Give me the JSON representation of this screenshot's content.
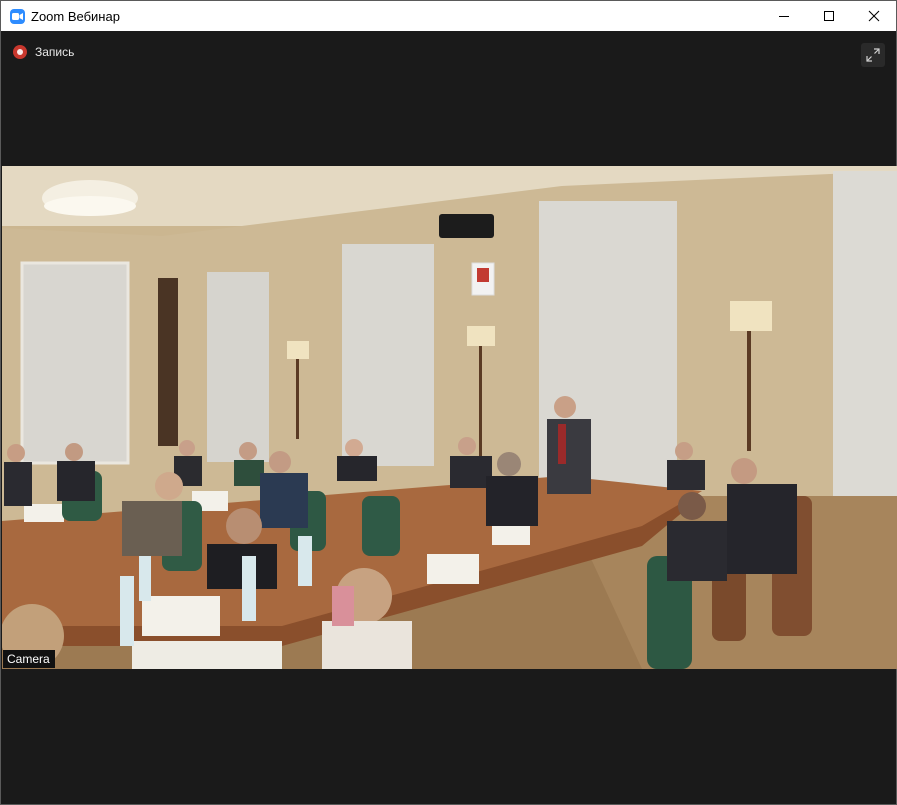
{
  "window": {
    "title": "Zoom Вебинар",
    "controls": {
      "minimize_icon": "minimize-icon",
      "maximize_icon": "maximize-icon",
      "close_icon": "close-icon"
    }
  },
  "recording": {
    "label": "Запись",
    "icon": "record-icon",
    "color": "#c8372d"
  },
  "toolbar": {
    "fullscreen_icon": "fullscreen-icon"
  },
  "video": {
    "description_icon": "video-feed",
    "participant_label": "Camera"
  },
  "colors": {
    "background": "#1a1a1a",
    "titlebar": "#ffffff",
    "accent": "#2d8cff"
  }
}
